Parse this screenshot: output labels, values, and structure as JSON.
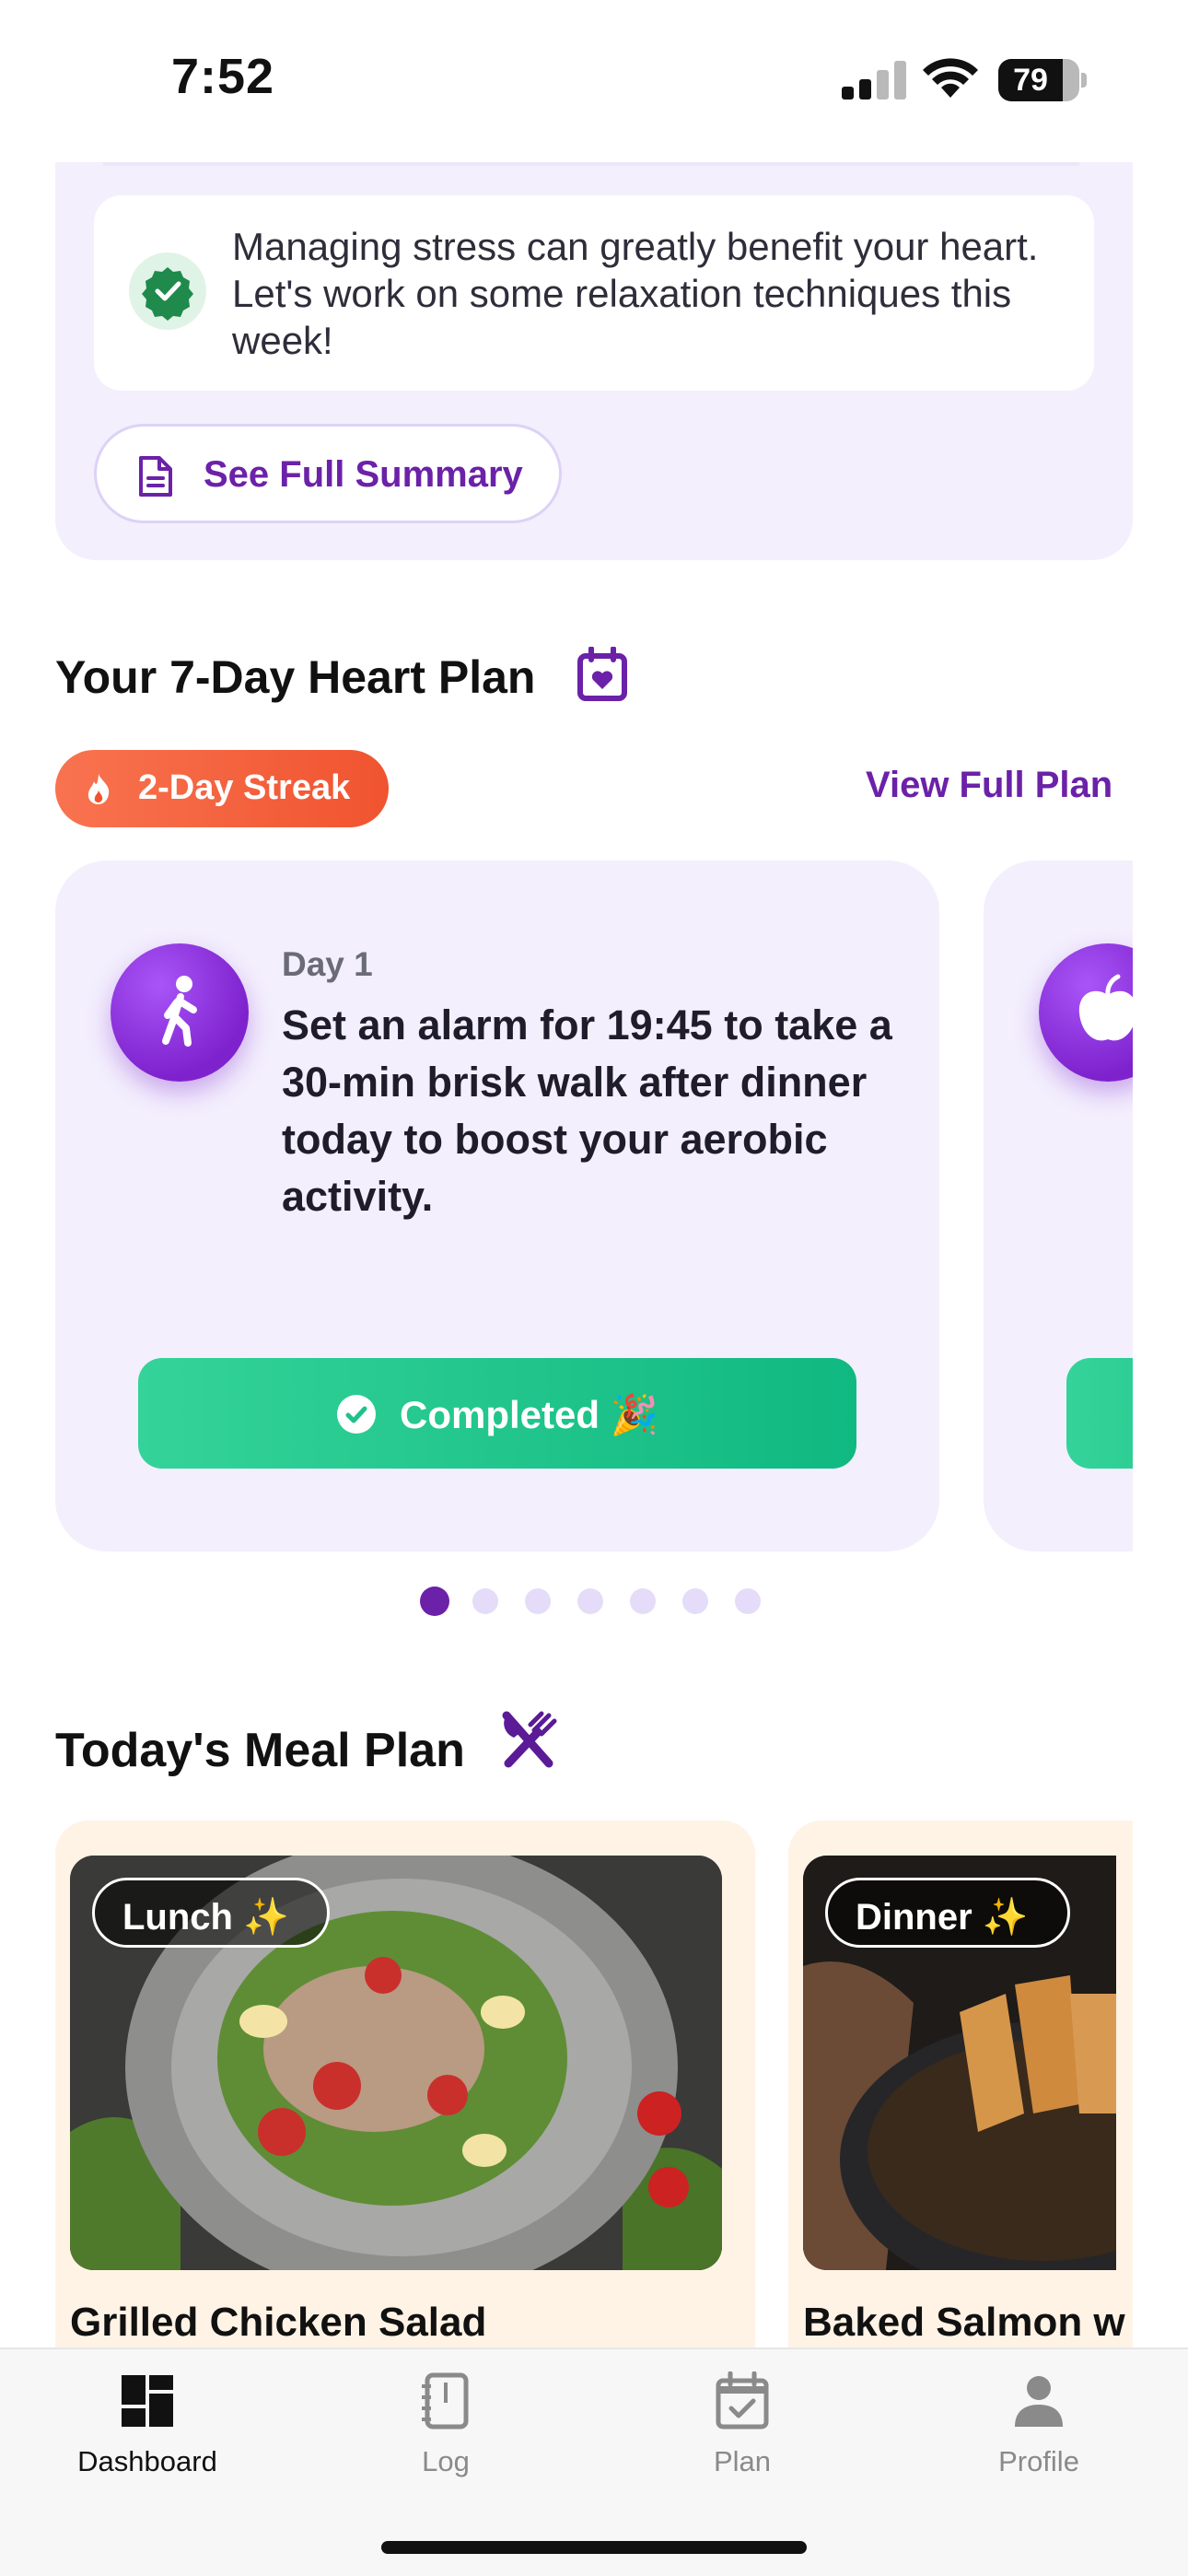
{
  "status_bar": {
    "time": "7:52",
    "battery": "79",
    "battery_level": 0.79
  },
  "summary": {
    "tip_text": "Managing stress can greatly benefit your heart. Let's work on some relaxation techniques this week!",
    "see_summary_label": "See Full Summary"
  },
  "plan": {
    "title": "Your 7-Day Heart Plan",
    "streak_label": "2-Day Streak",
    "view_full_plan_label": "View Full Plan",
    "cards": [
      {
        "day_label": "Day 1",
        "text": "Set an alarm for 19:45 to take a 30-min brisk walk after dinner today to boost your aerobic activity.",
        "icon": "walking-person-icon",
        "button_label": "Completed 🎉"
      },
      {
        "icon": "apple-icon"
      }
    ],
    "pagination": {
      "total": 7,
      "active_index": 0
    }
  },
  "meals": {
    "title": "Today's Meal Plan",
    "items": [
      {
        "tag": "Lunch ✨",
        "name": "Grilled Chicken Salad"
      },
      {
        "tag": "Dinner ✨",
        "name": "Baked Salmon w"
      }
    ]
  },
  "tabs": [
    {
      "label": "Dashboard",
      "icon": "dashboard-icon",
      "active": true
    },
    {
      "label": "Log",
      "icon": "notebook-icon",
      "active": false
    },
    {
      "label": "Plan",
      "icon": "calendar-check-icon",
      "active": false
    },
    {
      "label": "Profile",
      "icon": "person-icon",
      "active": false
    }
  ],
  "colors": {
    "accent": "#6b21a8",
    "card_bg": "#f3effd",
    "success": "#10b981",
    "streak": "#f0542f",
    "meal_card_bg": "#fff3e6"
  }
}
